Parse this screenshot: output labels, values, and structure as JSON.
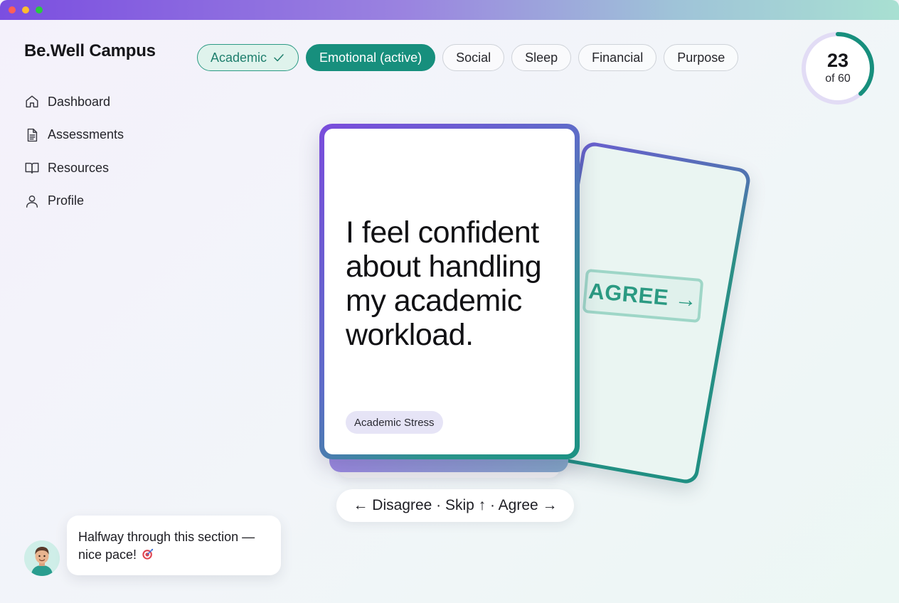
{
  "app": {
    "name": "Be.Well Campus"
  },
  "sidebar": {
    "items": [
      {
        "label": "Dashboard",
        "icon": "home-icon"
      },
      {
        "label": "Assessments",
        "icon": "document-icon"
      },
      {
        "label": "Resources",
        "icon": "book-icon"
      },
      {
        "label": "Profile",
        "icon": "user-icon"
      }
    ]
  },
  "tabs": [
    {
      "label": "Academic",
      "state": "completed",
      "icon": "checkmark-icon"
    },
    {
      "label": "Emotional (active)",
      "state": "active"
    },
    {
      "label": "Social",
      "state": "default"
    },
    {
      "label": "Sleep",
      "state": "default"
    },
    {
      "label": "Financial",
      "state": "default"
    },
    {
      "label": "Purpose",
      "state": "default"
    }
  ],
  "progress": {
    "current": "23",
    "total_label": "of 60",
    "fraction": 0.383
  },
  "card": {
    "statement": "I feel confident about handling my academic workload.",
    "category": "Academic Stress"
  },
  "back_card": {
    "stamp": "AGREE →"
  },
  "hint": {
    "text": "← Disagree · Skip ↑ · Agree →"
  },
  "coach": {
    "message": "Halfway through this section — nice pace!",
    "icon": "target-icon"
  },
  "colors": {
    "accent": "#178f7d",
    "accent_light": "#dff3ec",
    "purple": "#7a4cdc",
    "ring_track": "#e2dcf5",
    "stamp": "#2b9a82"
  }
}
